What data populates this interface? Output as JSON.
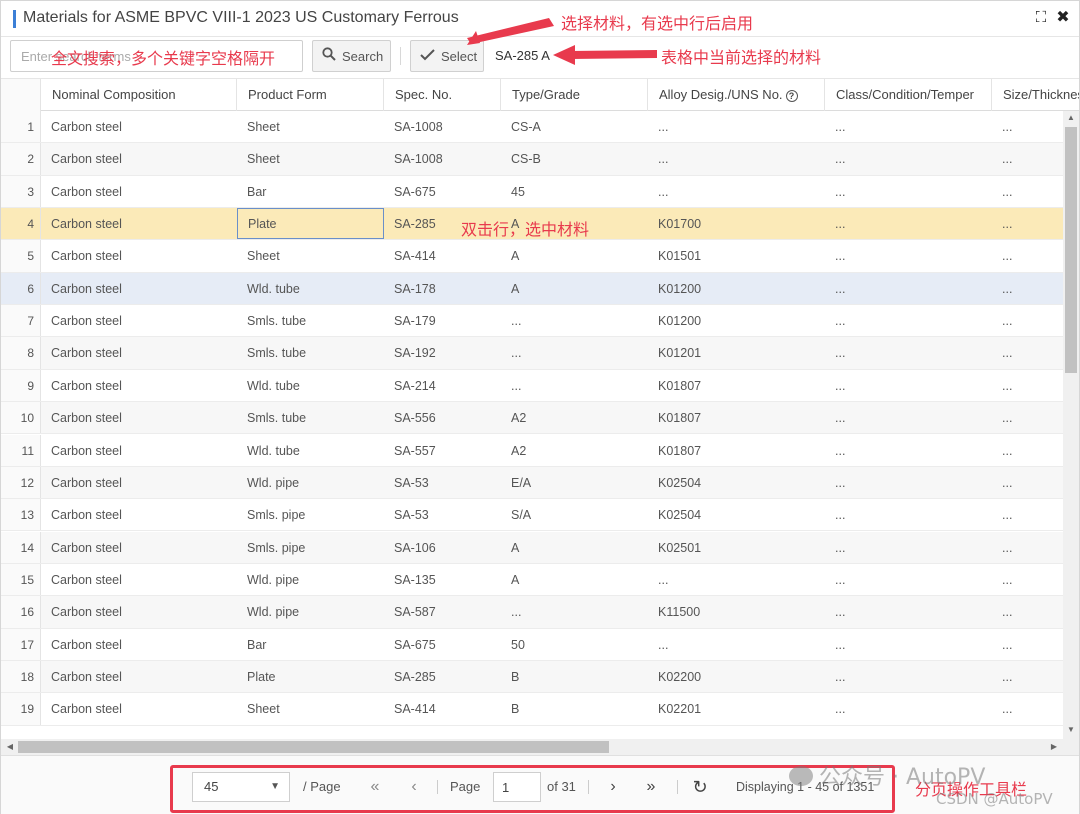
{
  "window": {
    "title": "Materials for ASME BPVC VIII-1 2023 US Customary Ferrous",
    "maximize_icon": "⛶",
    "close_icon": "✖"
  },
  "toolbar": {
    "search_placeholder": "Enter search terms",
    "search_label": "Search",
    "select_label": "Select",
    "current_material": "SA-285 A"
  },
  "grid": {
    "columns": [
      "Nominal Composition",
      "Product Form",
      "Spec. No.",
      "Type/Grade",
      "Alloy Desig./UNS No.",
      "Class/Condition/Temper",
      "Size/Thickness"
    ],
    "selected_row": 4,
    "hover_row": 6,
    "rows": [
      {
        "n": "1",
        "comp": "Carbon steel",
        "form": "Sheet",
        "spec": "SA-1008",
        "grade": "CS-A",
        "uns": "...",
        "cls": "...",
        "size": "..."
      },
      {
        "n": "2",
        "comp": "Carbon steel",
        "form": "Sheet",
        "spec": "SA-1008",
        "grade": "CS-B",
        "uns": "...",
        "cls": "...",
        "size": "..."
      },
      {
        "n": "3",
        "comp": "Carbon steel",
        "form": "Bar",
        "spec": "SA-675",
        "grade": "45",
        "uns": "...",
        "cls": "...",
        "size": "..."
      },
      {
        "n": "4",
        "comp": "Carbon steel",
        "form": "Plate",
        "spec": "SA-285",
        "grade": "A",
        "uns": "K01700",
        "cls": "...",
        "size": "..."
      },
      {
        "n": "5",
        "comp": "Carbon steel",
        "form": "Sheet",
        "spec": "SA-414",
        "grade": "A",
        "uns": "K01501",
        "cls": "...",
        "size": "..."
      },
      {
        "n": "6",
        "comp": "Carbon steel",
        "form": "Wld. tube",
        "spec": "SA-178",
        "grade": "A",
        "uns": "K01200",
        "cls": "...",
        "size": "..."
      },
      {
        "n": "7",
        "comp": "Carbon steel",
        "form": "Smls. tube",
        "spec": "SA-179",
        "grade": "...",
        "uns": "K01200",
        "cls": "...",
        "size": "..."
      },
      {
        "n": "8",
        "comp": "Carbon steel",
        "form": "Smls. tube",
        "spec": "SA-192",
        "grade": "...",
        "uns": "K01201",
        "cls": "...",
        "size": "..."
      },
      {
        "n": "9",
        "comp": "Carbon steel",
        "form": "Wld. tube",
        "spec": "SA-214",
        "grade": "...",
        "uns": "K01807",
        "cls": "...",
        "size": "..."
      },
      {
        "n": "10",
        "comp": "Carbon steel",
        "form": "Smls. tube",
        "spec": "SA-556",
        "grade": "A2",
        "uns": "K01807",
        "cls": "...",
        "size": "..."
      },
      {
        "n": "11",
        "comp": "Carbon steel",
        "form": "Wld. tube",
        "spec": "SA-557",
        "grade": "A2",
        "uns": "K01807",
        "cls": "...",
        "size": "..."
      },
      {
        "n": "12",
        "comp": "Carbon steel",
        "form": "Wld. pipe",
        "spec": "SA-53",
        "grade": "E/A",
        "uns": "K02504",
        "cls": "...",
        "size": "..."
      },
      {
        "n": "13",
        "comp": "Carbon steel",
        "form": "Smls. pipe",
        "spec": "SA-53",
        "grade": "S/A",
        "uns": "K02504",
        "cls": "...",
        "size": "..."
      },
      {
        "n": "14",
        "comp": "Carbon steel",
        "form": "Smls. pipe",
        "spec": "SA-106",
        "grade": "A",
        "uns": "K02501",
        "cls": "...",
        "size": "..."
      },
      {
        "n": "15",
        "comp": "Carbon steel",
        "form": "Wld. pipe",
        "spec": "SA-135",
        "grade": "A",
        "uns": "...",
        "cls": "...",
        "size": "..."
      },
      {
        "n": "16",
        "comp": "Carbon steel",
        "form": "Wld. pipe",
        "spec": "SA-587",
        "grade": "...",
        "uns": "K11500",
        "cls": "...",
        "size": "..."
      },
      {
        "n": "17",
        "comp": "Carbon steel",
        "form": "Bar",
        "spec": "SA-675",
        "grade": "50",
        "uns": "...",
        "cls": "...",
        "size": "..."
      },
      {
        "n": "18",
        "comp": "Carbon steel",
        "form": "Plate",
        "spec": "SA-285",
        "grade": "B",
        "uns": "K02200",
        "cls": "...",
        "size": "..."
      },
      {
        "n": "19",
        "comp": "Carbon steel",
        "form": "Sheet",
        "spec": "SA-414",
        "grade": "B",
        "uns": "K02201",
        "cls": "...",
        "size": "..."
      }
    ]
  },
  "pager": {
    "page_size": "45",
    "per_page_label": "/ Page",
    "page_label": "Page",
    "current_page": "1",
    "of_pages": "of 31",
    "displaying": "Displaying 1 - 45 of 1351",
    "first_icon": "«",
    "prev_icon": "‹",
    "next_icon": "›",
    "last_icon": "»",
    "refresh_icon": "↻"
  },
  "annotations": {
    "select_enable": "选择材料，有选中行后启用",
    "search_hint": "全文搜索，多个关键字空格隔开",
    "current_material_note": "表格中当前选择的材料",
    "double_click": "双击行，选中材料",
    "pager_note": "分页操作工具栏",
    "accent_color": "#e83a4d"
  },
  "watermark": {
    "wechat": "公众号 · AutoPV",
    "csdn": "CSDN @AutoPV"
  }
}
